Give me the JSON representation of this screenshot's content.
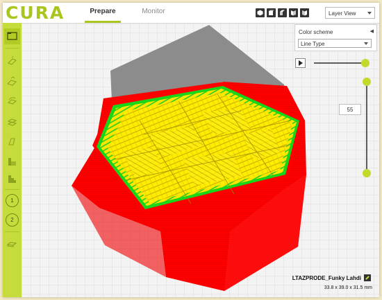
{
  "app": {
    "logo": "CURA",
    "brand_color": "#a9c61e"
  },
  "tabs": [
    {
      "label": "Prepare",
      "active": true
    },
    {
      "label": "Monitor",
      "active": false
    }
  ],
  "view_buttons": [
    "3d-view-icon",
    "front-view-icon",
    "top-view-icon",
    "left-view-icon",
    "right-view-icon"
  ],
  "view_mode": {
    "selected": "Layer View"
  },
  "sidebar": {
    "tools": [
      "open-file-icon",
      "translate-icon",
      "scale-icon",
      "rotate-icon",
      "mirror-icon",
      "per-model-settings-icon",
      "support-icon"
    ],
    "extruders": [
      "1",
      "2"
    ],
    "bottom": "slice-layout-icon"
  },
  "color_scheme": {
    "label": "Color scheme",
    "selected": "Line Type"
  },
  "layer_slider": {
    "current_layer": "55",
    "max_position": 1.0,
    "min_position": 0.0
  },
  "object": {
    "name": "LTAZPRODE_Funky Lahdi",
    "dimensions": "33.8 x 39.0 x 31.5 mm"
  },
  "colors": {
    "wall": "#ff0000",
    "inner_wall": "#00dd00",
    "infill": "#ffe800",
    "shadow": "#8c8c8c"
  }
}
